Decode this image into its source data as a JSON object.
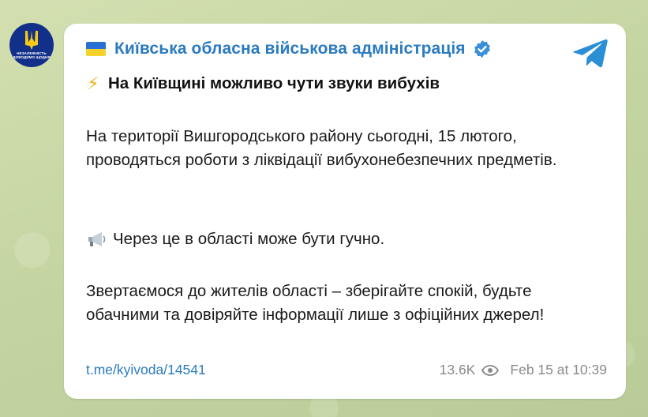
{
  "channel": {
    "name": "Київська обласна військова адміністрація",
    "avatar_text": "НЕЗАЛЕЖНІСТЬ ДОВОДИМО ЩОДНЯ",
    "flag_icon": "ukraine-flag-icon",
    "verified_icon": "verified-badge-icon",
    "app_icon": "telegram-icon"
  },
  "post": {
    "headline_icon": "high-voltage-icon",
    "headline": "На Київщині можливо чути звуки вибухів",
    "paragraph1": "На території Вишгородського району сьогодні, 15 лютого, проводяться роботи з ліквідації вибухонебезпечних предметів.",
    "paragraph2_icon": "megaphone-icon",
    "paragraph2": "Через це в області може бути гучно.",
    "paragraph3": "Звертаємося до жителів області – зберігайте спокій, будьте обачними та довіряйте інформації лише з офіційних джерел!",
    "link": "t.me/kyivoda/14541",
    "views": "13.6K",
    "views_icon": "eye-icon",
    "date": "Feb 15 at 10:39"
  },
  "colors": {
    "accent": "#2b7bc0",
    "background": "#c9d7a7",
    "bubble": "#ffffff"
  }
}
